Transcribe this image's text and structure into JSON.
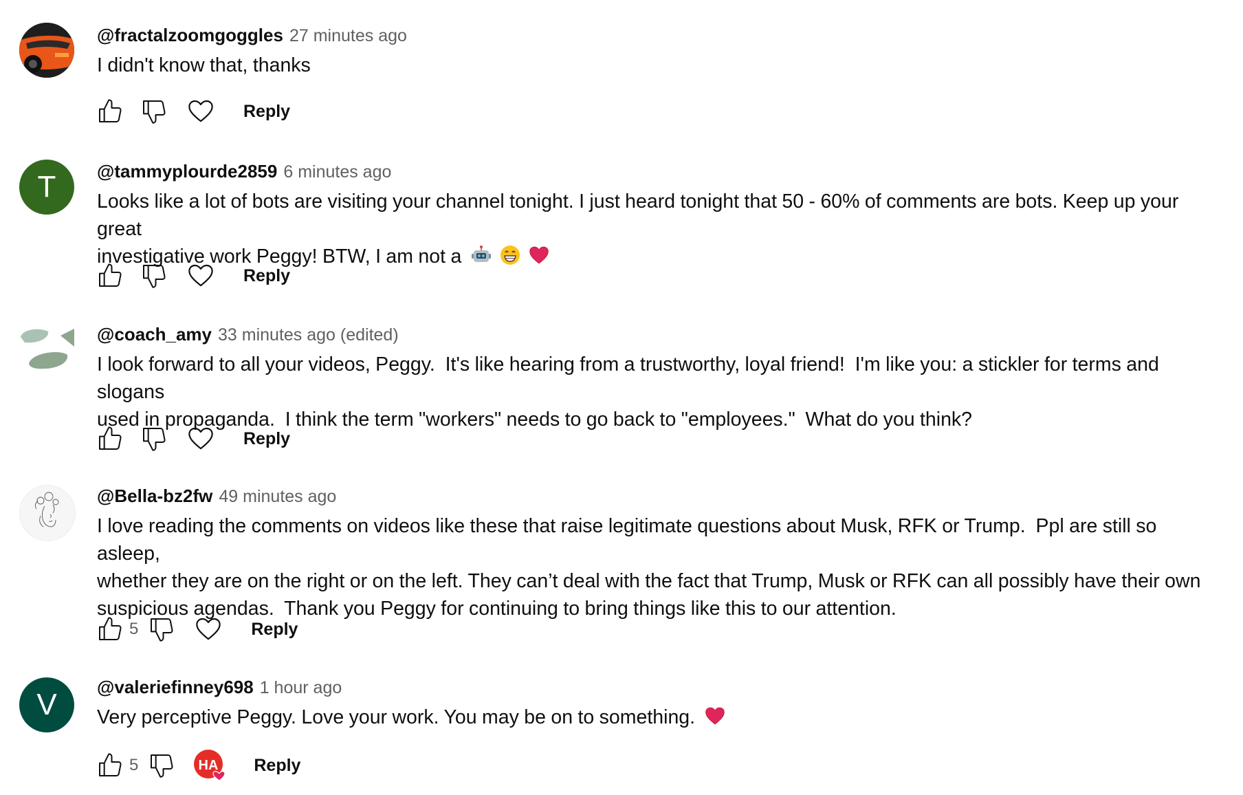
{
  "comments": [
    {
      "handle": "@fractalzoomgoggles",
      "time": "27 minutes ago",
      "text": "I didn't know that, thanks",
      "avatar": {
        "kind": "photo",
        "icon": "orange-car-avatar"
      },
      "likes": "",
      "reply_label": "Reply"
    },
    {
      "handle": "@tammyplourde2859",
      "time": "6 minutes ago",
      "text_lines": [
        "Looks like a lot of bots are visiting your channel tonight. I just heard tonight that 50 - 60% of comments are bots. Keep up your great",
        "investigative work Peggy! BTW, I am not a"
      ],
      "emojis": [
        "robot-emoji",
        "grinning-emoji",
        "red-heart-emoji"
      ],
      "avatar": {
        "kind": "letter",
        "letter": "T",
        "color": "#33691e"
      },
      "likes": "",
      "reply_label": "Reply"
    },
    {
      "handle": "@coach_amy",
      "time": "33 minutes ago (edited)",
      "text_lines": [
        "I look forward to all your videos, Peggy.  It's like hearing from a trustworthy, loyal friend!  I'm like you: a stickler for terms and slogans",
        "used in propaganda.  I think the term \"workers\" needs to go back to \"employees.\"  What do you think?"
      ],
      "avatar": {
        "kind": "logo",
        "icon": "green-shapes-avatar"
      },
      "likes": "",
      "reply_label": "Reply"
    },
    {
      "handle": "@Bella-bz2fw",
      "time": "49 minutes ago",
      "text_lines": [
        "I love reading the comments on videos like these that raise legitimate questions about Musk, RFK or Trump.  Ppl are still so asleep,",
        "whether they are on the right or on the left. They can’t deal with the fact that Trump, Musk or RFK can all possibly have their own",
        "suspicious agendas.  Thank you Peggy for continuing to bring things like this to our attention."
      ],
      "avatar": {
        "kind": "sketch",
        "icon": "floral-face-sketch-avatar"
      },
      "likes": "5",
      "reply_label": "Reply"
    },
    {
      "handle": "@valeriefinney698",
      "time": "1 hour ago",
      "text": "Very perceptive Peggy. Love your work. You may be on to something.",
      "emojis": [
        "red-heart-emoji"
      ],
      "avatar": {
        "kind": "letter",
        "letter": "V",
        "color": "#004d40"
      },
      "likes": "5",
      "creator_heart": {
        "badge_text": "HA",
        "badge_color": "#e52d27"
      },
      "reply_label": "Reply"
    }
  ],
  "colors": {
    "text": "#0f0f0f",
    "secondary": "#606060",
    "heart": "#e0245e"
  }
}
